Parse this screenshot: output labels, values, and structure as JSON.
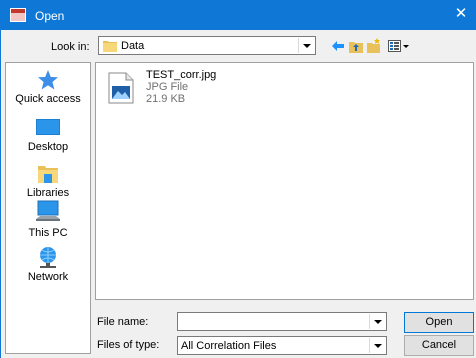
{
  "window": {
    "title": "Open",
    "close_glyph": "✕"
  },
  "look_in": {
    "label": "Look in:",
    "value": "Data"
  },
  "places": [
    {
      "label": "Quick access",
      "icon": "star-icon"
    },
    {
      "label": "Desktop",
      "icon": "desktop-icon"
    },
    {
      "label": "Libraries",
      "icon": "libraries-icon"
    },
    {
      "label": "This PC",
      "icon": "computer-icon"
    },
    {
      "label": "Network",
      "icon": "network-icon"
    }
  ],
  "files": [
    {
      "name": "TEST_corr.jpg",
      "type": "JPG File",
      "size": "21.9 KB",
      "icon": "image-file-icon"
    }
  ],
  "file_name": {
    "label": "File name:",
    "value": ""
  },
  "file_type": {
    "label": "Files of type:",
    "value": "All Correlation Files"
  },
  "buttons": {
    "open": "Open",
    "cancel": "Cancel"
  },
  "colors": {
    "titlebar": "#0f78d7",
    "accent": "#1e90ff"
  }
}
